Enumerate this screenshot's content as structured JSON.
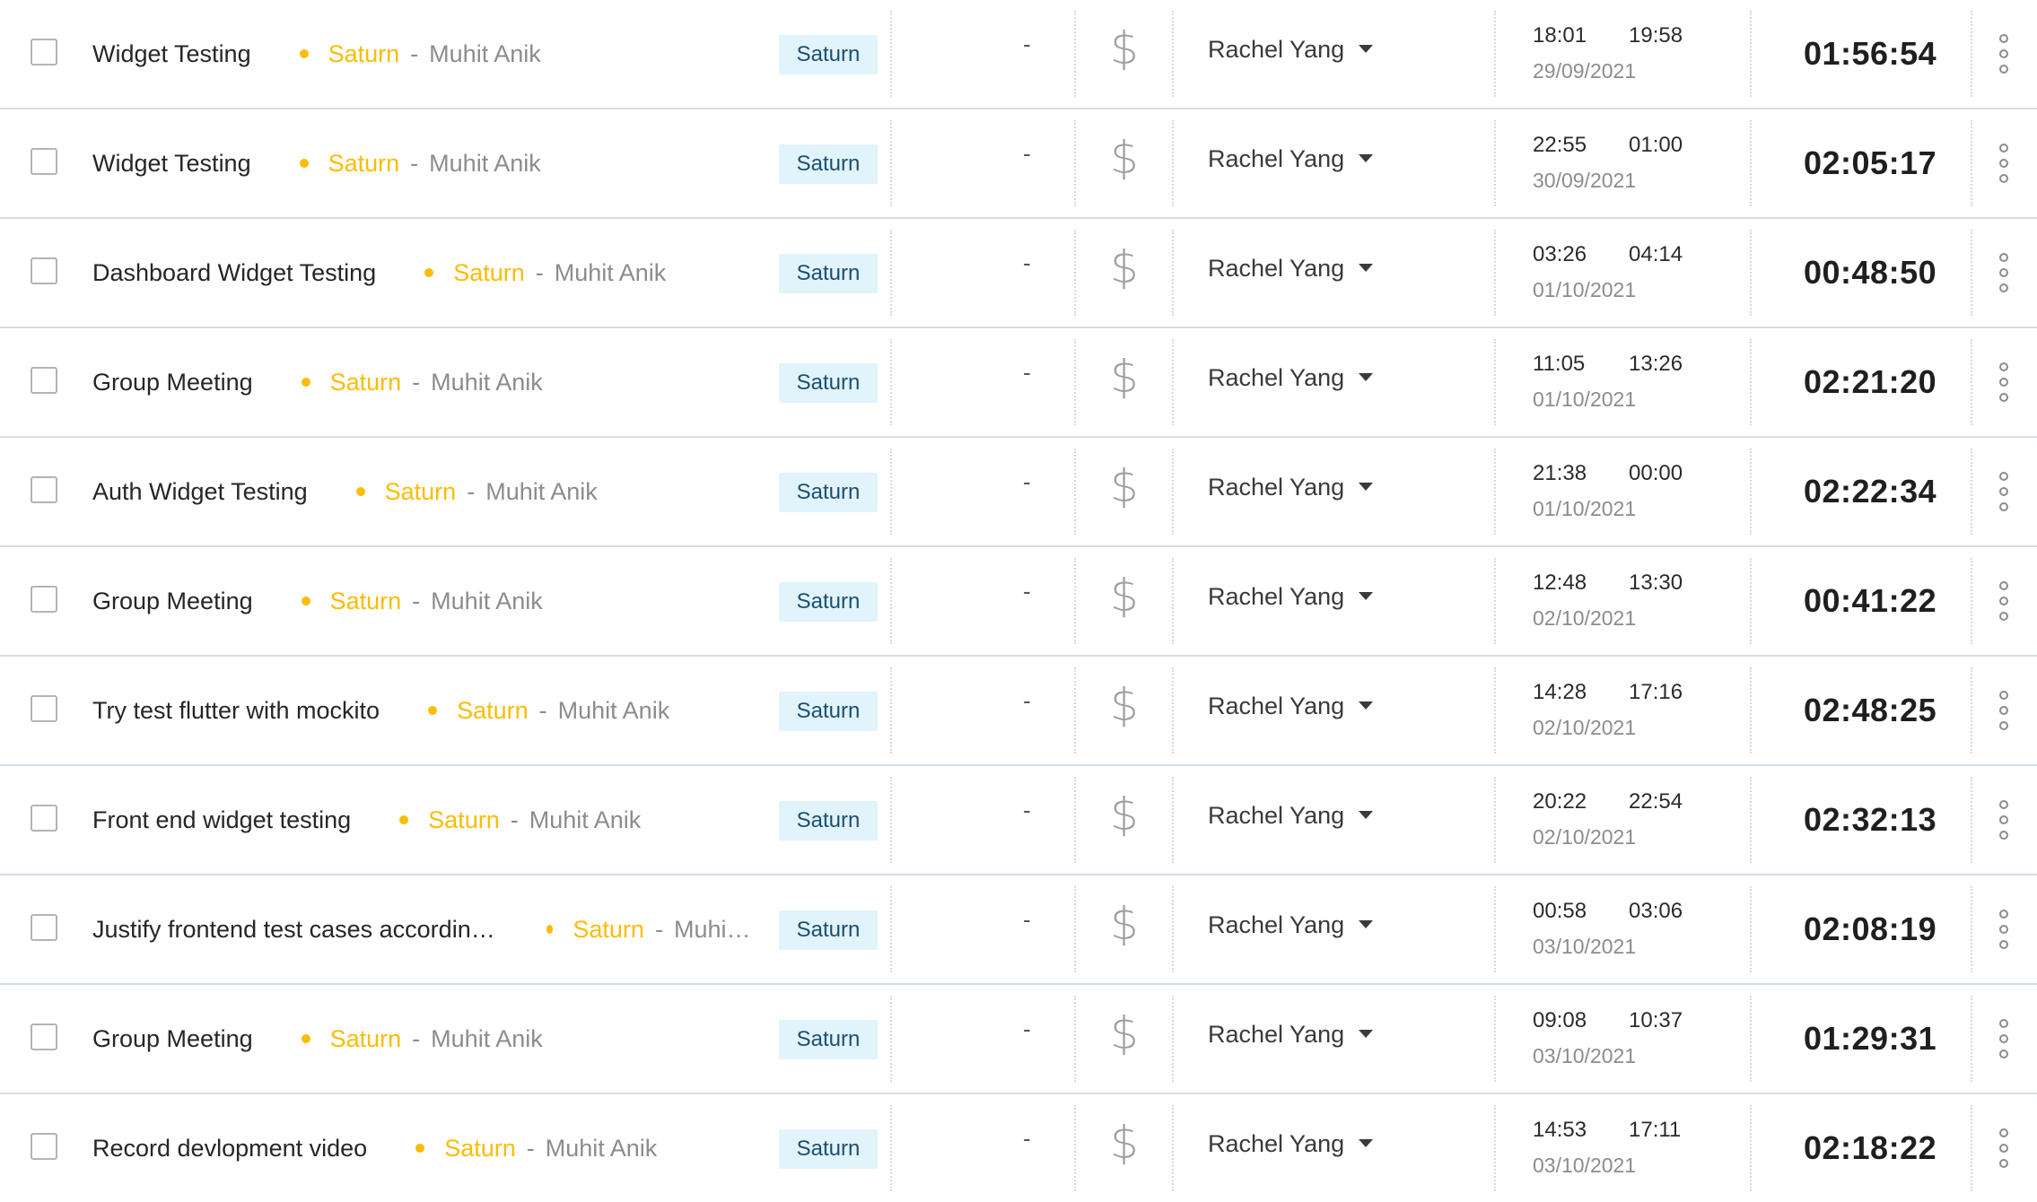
{
  "icons": {
    "checkbox": "checkbox-icon",
    "status_dot": "status-dot-icon",
    "billable": "dollar-icon",
    "user_dropdown": "caret-down-icon",
    "more": "kebab-menu-icon"
  },
  "colors": {
    "project": "#fbbc04",
    "tag_background": "#e1f3fb",
    "row_divider": "#d2dde8"
  },
  "entries": [
    {
      "description": "Widget Testing",
      "project": "Saturn",
      "separator": "-",
      "client": "Muhit Anik",
      "tag": "Saturn",
      "empty": "-",
      "billable_symbol": "$",
      "user": "Rachel Yang",
      "start": "18:01",
      "end": "19:58",
      "date": "29/09/2021",
      "duration": "01:56:54"
    },
    {
      "description": "Widget Testing",
      "project": "Saturn",
      "separator": "-",
      "client": "Muhit Anik",
      "tag": "Saturn",
      "empty": "-",
      "billable_symbol": "$",
      "user": "Rachel Yang",
      "start": "22:55",
      "end": "01:00",
      "date": "30/09/2021",
      "duration": "02:05:17"
    },
    {
      "description": "Dashboard Widget Testing",
      "project": "Saturn",
      "separator": "-",
      "client": "Muhit Anik",
      "tag": "Saturn",
      "empty": "-",
      "billable_symbol": "$",
      "user": "Rachel Yang",
      "start": "03:26",
      "end": "04:14",
      "date": "01/10/2021",
      "duration": "00:48:50"
    },
    {
      "description": "Group Meeting",
      "project": "Saturn",
      "separator": "-",
      "client": "Muhit Anik",
      "tag": "Saturn",
      "empty": "-",
      "billable_symbol": "$",
      "user": "Rachel Yang",
      "start": "11:05",
      "end": "13:26",
      "date": "01/10/2021",
      "duration": "02:21:20"
    },
    {
      "description": "Auth Widget Testing",
      "project": "Saturn",
      "separator": "-",
      "client": "Muhit Anik",
      "tag": "Saturn",
      "empty": "-",
      "billable_symbol": "$",
      "user": "Rachel Yang",
      "start": "21:38",
      "end": "00:00",
      "date": "01/10/2021",
      "duration": "02:22:34"
    },
    {
      "description": "Group Meeting",
      "project": "Saturn",
      "separator": "-",
      "client": "Muhit Anik",
      "tag": "Saturn",
      "empty": "-",
      "billable_symbol": "$",
      "user": "Rachel Yang",
      "start": "12:48",
      "end": "13:30",
      "date": "02/10/2021",
      "duration": "00:41:22"
    },
    {
      "description": "Try test flutter with mockito",
      "project": "Saturn",
      "separator": "-",
      "client": "Muhit Anik",
      "tag": "Saturn",
      "empty": "-",
      "billable_symbol": "$",
      "user": "Rachel Yang",
      "start": "14:28",
      "end": "17:16",
      "date": "02/10/2021",
      "duration": "02:48:25"
    },
    {
      "description": "Front end widget testing",
      "project": "Saturn",
      "separator": "-",
      "client": "Muhit Anik",
      "tag": "Saturn",
      "empty": "-",
      "billable_symbol": "$",
      "user": "Rachel Yang",
      "start": "20:22",
      "end": "22:54",
      "date": "02/10/2021",
      "duration": "02:32:13"
    },
    {
      "description": "Justify frontend test cases according to requirements",
      "project": "Saturn",
      "separator": "-",
      "client": "Muhit Anik",
      "tag": "Saturn",
      "empty": "-",
      "billable_symbol": "$",
      "user": "Rachel Yang",
      "start": "00:58",
      "end": "03:06",
      "date": "03/10/2021",
      "duration": "02:08:19"
    },
    {
      "description": "Group Meeting",
      "project": "Saturn",
      "separator": "-",
      "client": "Muhit Anik",
      "tag": "Saturn",
      "empty": "-",
      "billable_symbol": "$",
      "user": "Rachel Yang",
      "start": "09:08",
      "end": "10:37",
      "date": "03/10/2021",
      "duration": "01:29:31"
    },
    {
      "description": "Record devlopment video",
      "project": "Saturn",
      "separator": "-",
      "client": "Muhit Anik",
      "tag": "Saturn",
      "empty": "-",
      "billable_symbol": "$",
      "user": "Rachel Yang",
      "start": "14:53",
      "end": "17:11",
      "date": "03/10/2021",
      "duration": "02:18:22"
    }
  ]
}
